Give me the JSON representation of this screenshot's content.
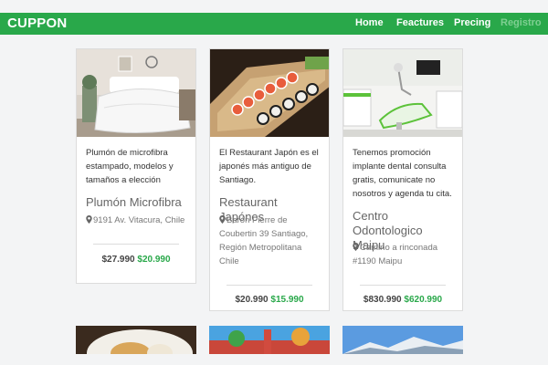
{
  "navbar": {
    "brand": "CUPPON",
    "links": [
      "Home",
      "Feactures",
      "Precing",
      "Registro"
    ]
  },
  "cards": [
    {
      "description": "Plumón de microfibra estampado, modelos y tamaños a elección",
      "name": "Plumón Microfibra",
      "address": "9191 Av. Vitacura, Chile",
      "old_price": "$27.990",
      "new_price": "$20.990"
    },
    {
      "description": "El Restaurant Japón es el japonés más antiguo de Santiago.",
      "name": "Restaurant Japónes",
      "address": "Barón Pierre de Coubertin 39 Santiago, Región Metropolitana Chile",
      "old_price": "$20.990",
      "new_price": "$15.990"
    },
    {
      "description": "Tenemos promoción implante dental consulta gratis, comunicate no nosotros y agenda tu cita.",
      "name": "Centro Odontologico Maipu",
      "address": "Camino a rinconada #1190 Maipu",
      "old_price": "$830.990",
      "new_price": "$620.990"
    }
  ],
  "colors": {
    "brand": "#29a84a",
    "background": "#f3f4f5"
  },
  "icons": [
    "map-marker-icon"
  ]
}
